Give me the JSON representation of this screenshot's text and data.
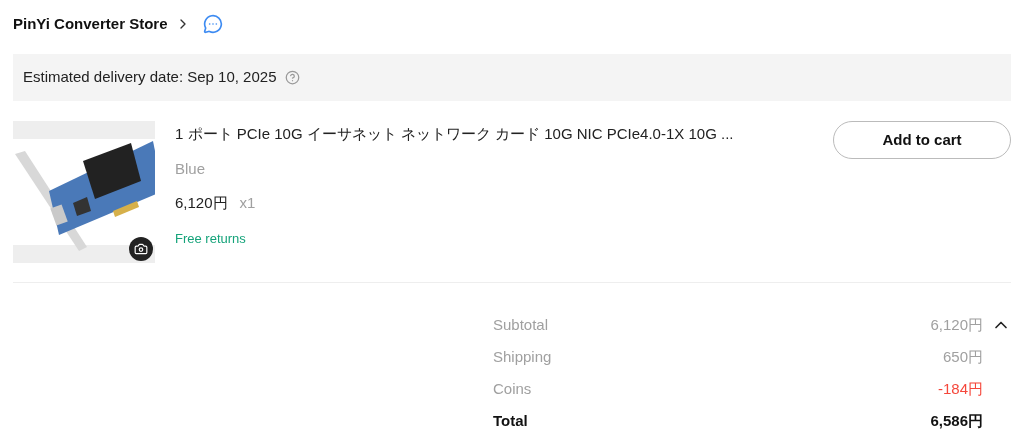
{
  "store": {
    "name": "PinYi Converter Store"
  },
  "delivery": {
    "text": "Estimated delivery date: Sep 10, 2025"
  },
  "item": {
    "title": "1 ポート PCIe 10G イーサネット ネットワーク カード 10G NIC PCIe4.0-1X 10G ...",
    "variant": "Blue",
    "price": "6,120円",
    "quantity": "x1",
    "returns": "Free returns",
    "button": "Add to cart"
  },
  "summary": {
    "expanded": true,
    "rows": [
      {
        "kind": "plain",
        "label": "Subtotal",
        "value": "6,120円"
      },
      {
        "kind": "plain",
        "label": "Shipping",
        "value": "650円"
      },
      {
        "kind": "discount",
        "label": "Coins",
        "value": "-184円"
      },
      {
        "kind": "total",
        "label": "Total",
        "value": "6,586円"
      }
    ]
  }
}
